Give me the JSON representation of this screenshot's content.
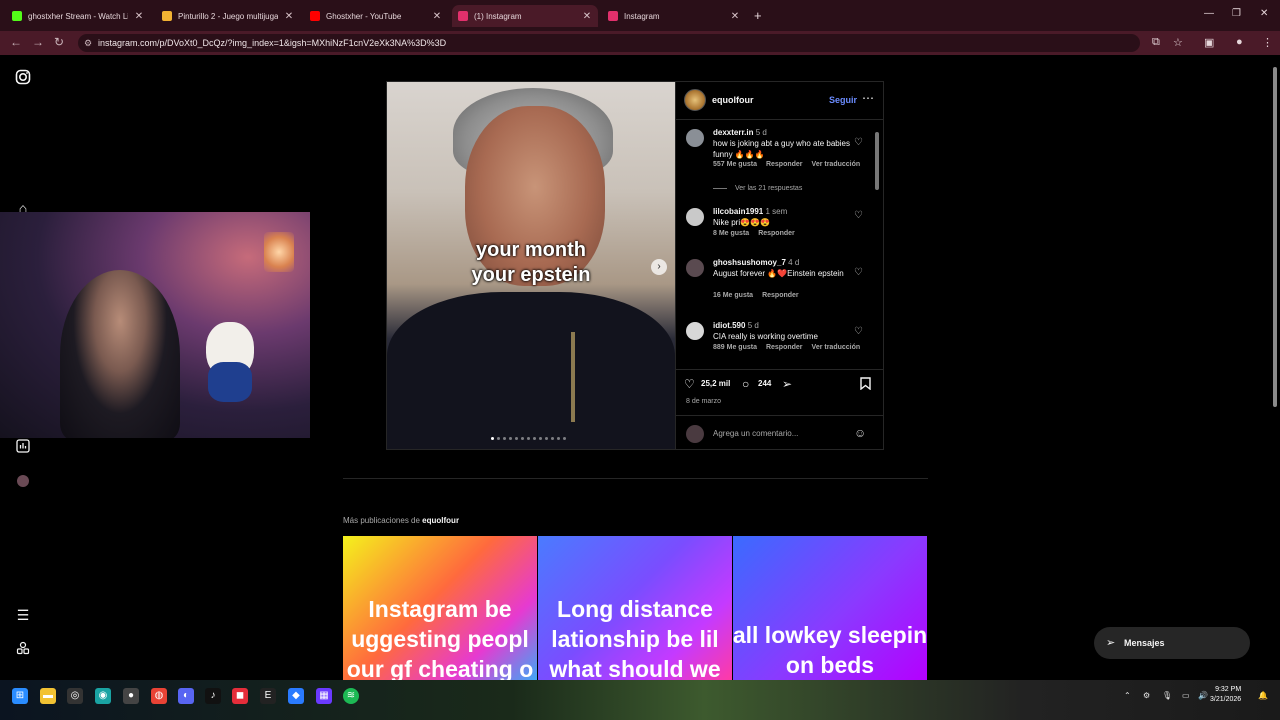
{
  "browser": {
    "tabs": [
      {
        "title": "ghostxher Stream - Watch Live",
        "favicon_color": "#53fc18",
        "active": false
      },
      {
        "title": "Pinturillo 2 - Juego multijugador",
        "favicon_color": "#f2b233",
        "active": false
      },
      {
        "title": "Ghostxher - YouTube",
        "favicon_color": "#ff0000",
        "active": false
      },
      {
        "title": "(1) Instagram",
        "favicon_color": "#e1306c",
        "active": true
      },
      {
        "title": "Instagram",
        "favicon_color": "#e1306c",
        "active": false
      }
    ],
    "new_tab": "+",
    "url": "instagram.com/p/DVoXt0_DcQz/?img_index=1&igsh=MXhiNzF1cnV2eXk3NA%3D%3D"
  },
  "post": {
    "username": "equolfour",
    "follow_label": "Seguir",
    "overlay_text_line1": "your month",
    "overlay_text_line2": "your epstein",
    "comments": [
      {
        "user": "dexxterr.in",
        "time": "5 d",
        "text": "how is joking abt a guy who ate babies funny 🔥🔥🔥",
        "likes": "557 Me gusta",
        "reply": "Responder",
        "translate": "Ver traducción"
      },
      {
        "user": "lilcobain1991",
        "time": "1 sem",
        "text": "Nike pri😍😍😍",
        "likes": "8 Me gusta",
        "reply": "Responder",
        "translate": ""
      },
      {
        "user": "ghoshsushomoy_7",
        "time": "4 d",
        "text": "August forever 🔥❤️Einstein epstein",
        "likes": "16 Me gusta",
        "reply": "Responder",
        "translate": ""
      },
      {
        "user": "idiot.590",
        "time": "5 d",
        "text": "CIA really is working overtime",
        "likes": "889 Me gusta",
        "reply": "Responder",
        "translate": "Ver traducción"
      }
    ],
    "view_replies": "Ver las 21 respuestas",
    "likes_count": "25,2 mil",
    "comments_count": "244",
    "date": "8 de marzo",
    "add_comment_placeholder": "Agrega un comentario...",
    "carousel_total": 13,
    "carousel_current": 1
  },
  "more_posts": {
    "prefix": "Más publicaciones de",
    "username": "equolfour",
    "items": [
      {
        "text": "Instagram be\nuggesting peopl\nour gf cheating o",
        "gradient": "linear-gradient(135deg,#f4f21c 0%,#ff6a3d 45%,#e63ad1 75%,#3fa7f5 100%)"
      },
      {
        "text": "Long distance\nlationship be lil\nwhat should we",
        "gradient": "linear-gradient(135deg,#4a7bff 0%,#7a4dff 45%,#c43aff 75%,#ff3aa5 100%)"
      },
      {
        "text": "all lowkey sleepin\non beds",
        "gradient": "linear-gradient(135deg,#3a6bff 0%,#8a3aff 55%,#b400ff 100%)"
      }
    ]
  },
  "messages_label": "Mensajes",
  "taskbar": {
    "time": "9:32 PM",
    "date": "3/21/2026"
  }
}
